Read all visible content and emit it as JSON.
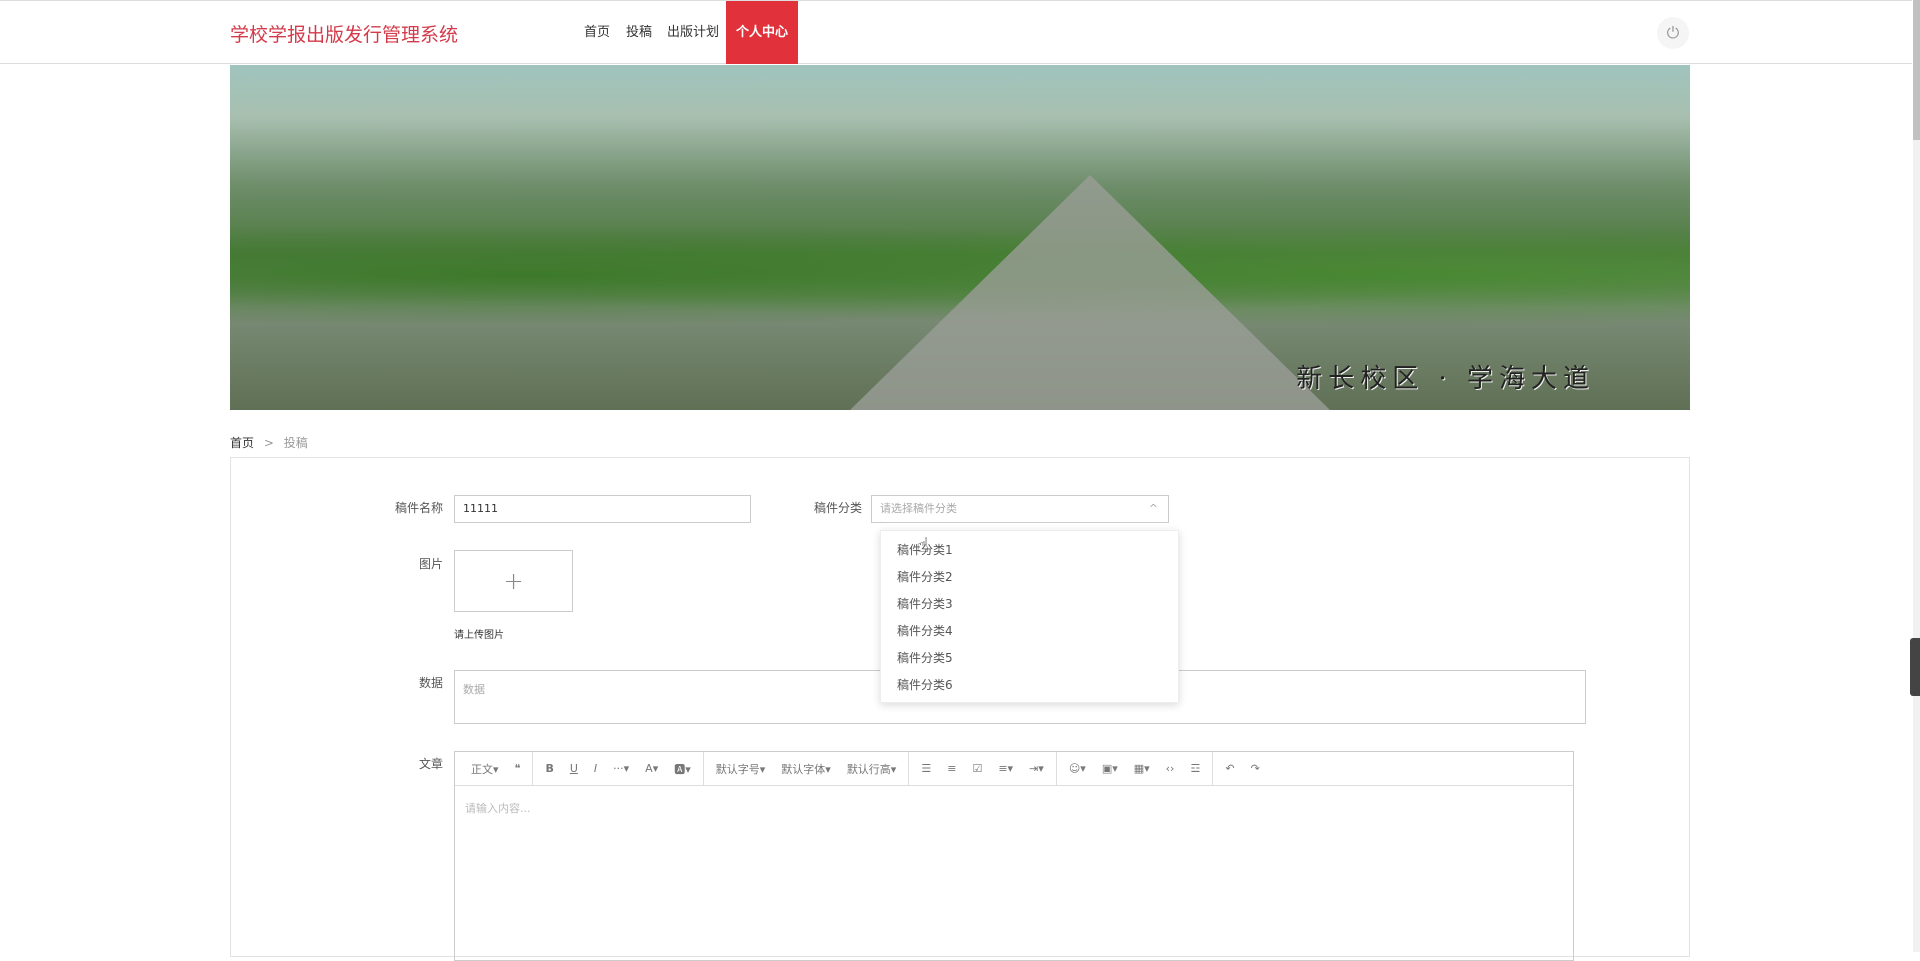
{
  "header": {
    "title": "学校学报出版发行管理系统",
    "nav": [
      "首页",
      "投稿",
      "出版计划",
      "个人中心"
    ],
    "active_nav": "个人中心",
    "power_icon": "power-icon"
  },
  "banner": {
    "caption": "新长校区 · 学海大道"
  },
  "breadcrumb": [
    "首页",
    ">",
    "投稿"
  ],
  "form": {
    "name_label": "稿件名称",
    "name_value": "11111",
    "category_label": "稿件分类",
    "category_placeholder": "请选择稿件分类",
    "chevron": "^",
    "category_options": [
      "稿件分类1",
      "稿件分类2",
      "稿件分类3",
      "稿件分类4",
      "稿件分类5",
      "稿件分类6"
    ],
    "image_label": "图片",
    "upload_plus": "+",
    "upload_hint": "请上传图片",
    "data_label": "数据",
    "data_placeholder": "数据",
    "article_label": "文章",
    "editor_placeholder": "请输入内容...",
    "toolbar": [
      "正文▾",
      "❝",
      "B",
      "U",
      "I",
      "···▾",
      "A▾",
      "🅰▾",
      "默认字号▾",
      "默认字体▾",
      "默认行高▾",
      "☰",
      "≡",
      "☑",
      "≡▾",
      "⇥▾",
      "☺▾",
      "▣▾",
      "▦▾",
      "‹›",
      "☲",
      "↶",
      "↷"
    ]
  }
}
